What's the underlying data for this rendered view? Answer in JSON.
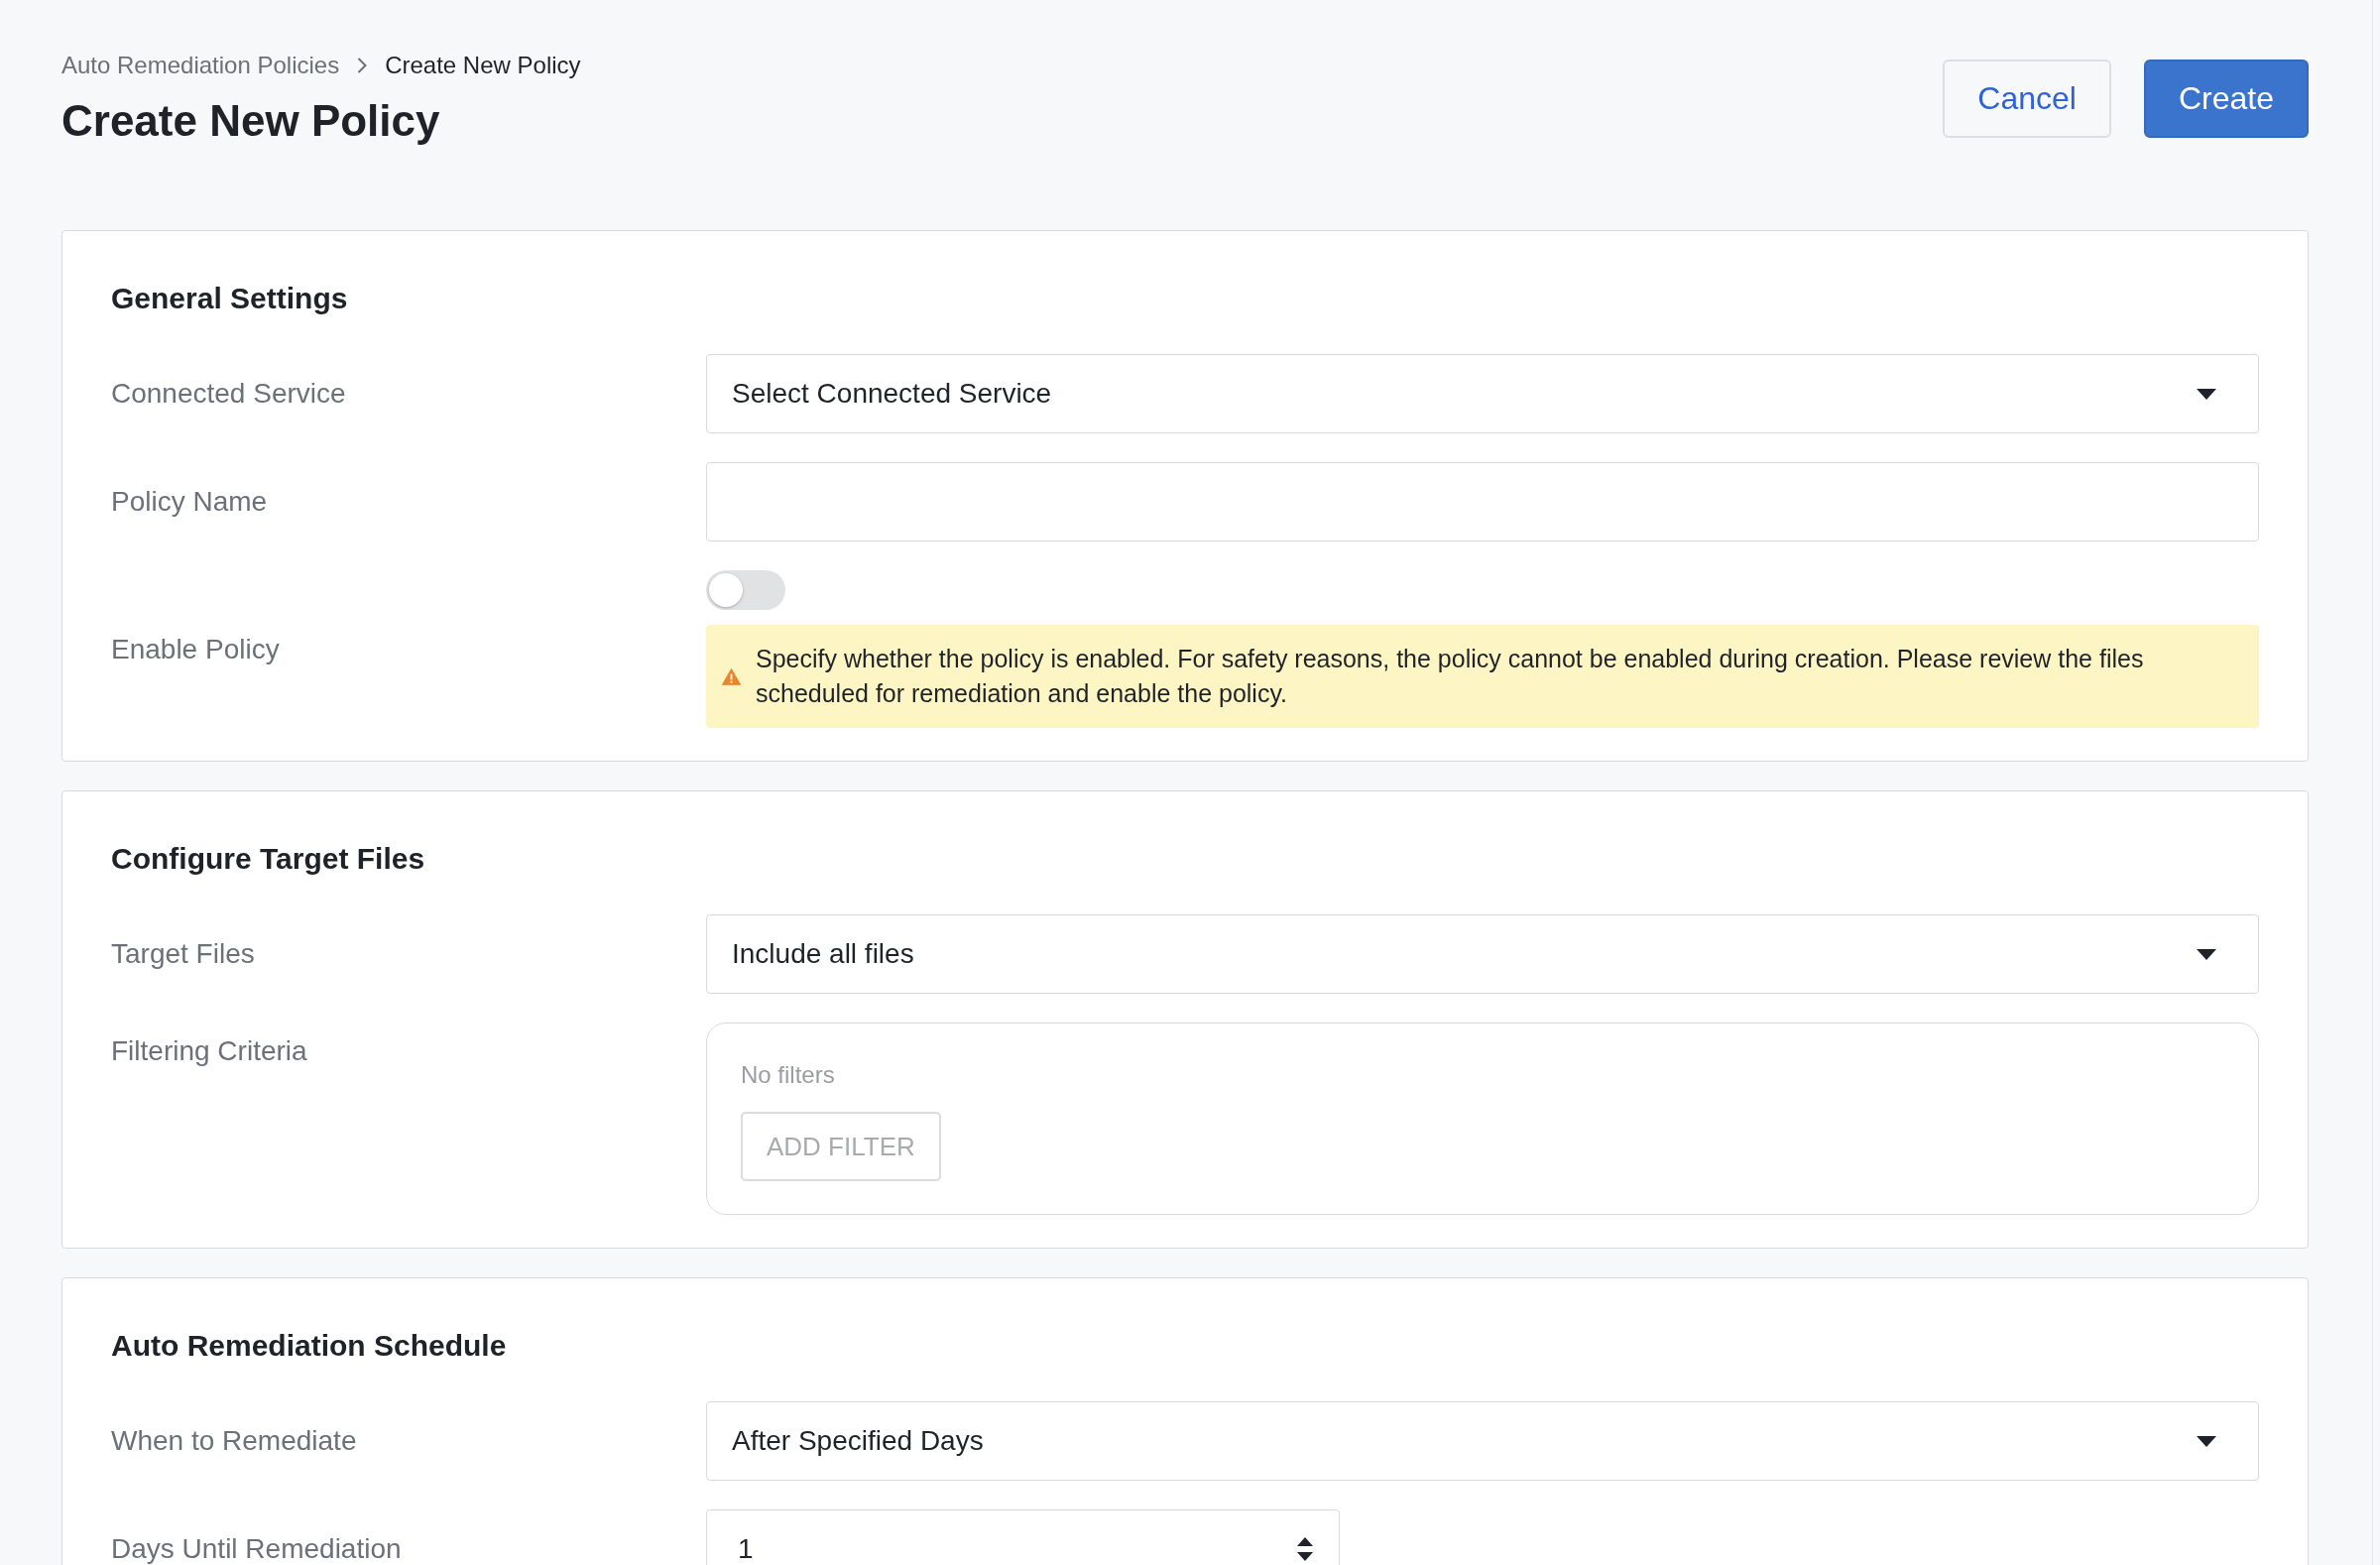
{
  "breadcrumb": [
    {
      "label": "Auto Remediation Policies",
      "current": false
    },
    {
      "label": "Create New Policy",
      "current": true
    }
  ],
  "title": "Create New Policy",
  "actions": [
    {
      "label": "Cancel",
      "kind": "secondary"
    },
    {
      "label": "Create",
      "kind": "primary"
    }
  ],
  "sections": [
    {
      "title": "General Settings",
      "fields": [
        {
          "kind": "select",
          "label": "Connected Service",
          "value": "Select Connected Service"
        },
        {
          "kind": "text",
          "label": "Policy Name"
        },
        {
          "kind": "toggle",
          "label": "Enable Policy",
          "on": false,
          "warning": "Specify whether the policy is enabled. For safety reasons, the policy cannot be enabled during creation. Please review the files scheduled for remediation and enable the policy."
        }
      ]
    },
    {
      "title": "Configure Target Files",
      "fields": [
        {
          "kind": "select",
          "label": "Target Files",
          "value": "Include all files"
        },
        {
          "kind": "filters",
          "label": "Filtering Criteria",
          "empty_text": "No filters",
          "button": {
            "label": "ADD FILTER",
            "disabled": true
          }
        }
      ]
    },
    {
      "title": "Auto Remediation Schedule",
      "fields": [
        {
          "kind": "select",
          "label": "When to Remediate",
          "value": "After Specified Days"
        },
        {
          "kind": "number",
          "label": "Days Until Remediation",
          "value": "1"
        }
      ]
    }
  ]
}
